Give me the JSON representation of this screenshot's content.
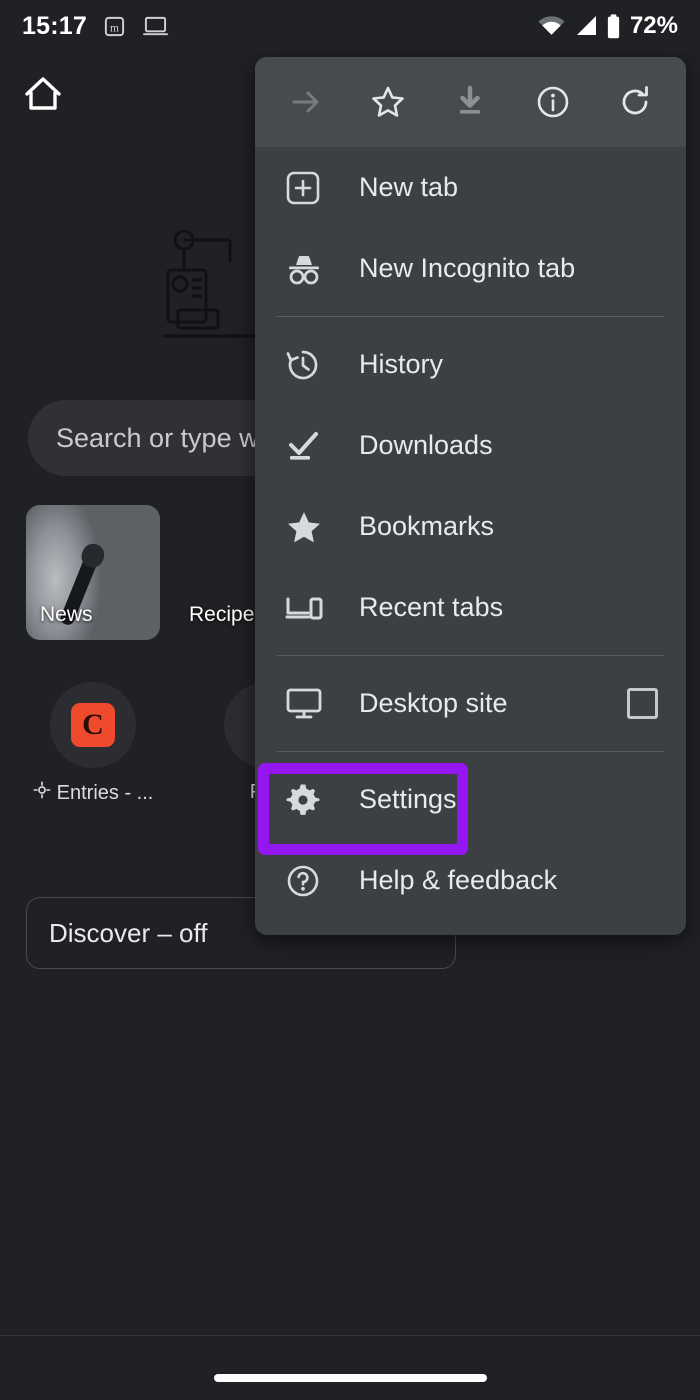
{
  "status_bar": {
    "clock": "15:17",
    "app_icon_letter": "m",
    "icons": [
      "app-m-icon",
      "laptop-icon",
      "wifi-icon",
      "cellular-signal-icon",
      "battery-icon"
    ],
    "battery_percent": "72%"
  },
  "ntp": {
    "home_icon": "home-icon",
    "illustration": "chrome-dino-spiral-illustration",
    "search": {
      "placeholder": "Search or type w",
      "full_placeholder": "Search or type web address"
    },
    "tiles": [
      {
        "label": "News",
        "image": "news-microphone-photo"
      },
      {
        "label": "Recipe",
        "image": "recipes-food-photo"
      }
    ],
    "shortcuts": [
      {
        "label": "Entries - ...",
        "icon": "location-crosshair-icon",
        "tile_letter": "C",
        "tile_color": "#ef4a2c"
      },
      {
        "label": "Pos",
        "icon": "",
        "tile_letter": "",
        "tile_color": ""
      }
    ],
    "discover": {
      "label": "Discover – off"
    }
  },
  "menu": {
    "toolbar": [
      {
        "name": "forward-arrow-icon",
        "label": "Forward",
        "dimmed": true
      },
      {
        "name": "star-outline-icon",
        "label": "Bookmark",
        "dimmed": false
      },
      {
        "name": "download-icon",
        "label": "Download",
        "dimmed": true
      },
      {
        "name": "info-circle-icon",
        "label": "Page info",
        "dimmed": false
      },
      {
        "name": "reload-icon",
        "label": "Reload",
        "dimmed": false
      }
    ],
    "items": [
      {
        "label": "New tab",
        "icon": "plus-square-icon"
      },
      {
        "label": "New Incognito tab",
        "icon": "incognito-icon"
      },
      {
        "label": "History",
        "icon": "history-clock-icon"
      },
      {
        "label": "Downloads",
        "icon": "download-check-icon"
      },
      {
        "label": "Bookmarks",
        "icon": "star-filled-icon"
      },
      {
        "label": "Recent tabs",
        "icon": "devices-icon"
      },
      {
        "label": "Desktop site",
        "icon": "monitor-icon",
        "checkbox": "unchecked"
      },
      {
        "label": "Settings",
        "icon": "gear-icon",
        "highlighted": true
      },
      {
        "label": "Help & feedback",
        "icon": "question-circle-icon"
      }
    ]
  },
  "annotation": {
    "highlight_color": "#9416f0",
    "highlight_target": "Settings"
  },
  "nav_bar": {
    "gesture_pill": "home-gesture-pill"
  }
}
